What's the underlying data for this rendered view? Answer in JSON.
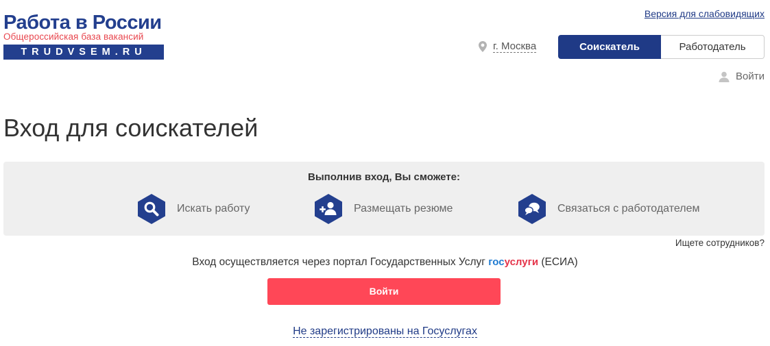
{
  "header": {
    "logo": {
      "title": "Работа в России",
      "subtitle": "Общероссийская база вакансий",
      "domain": "TRUDVSEM.RU"
    },
    "accessibility_link": "Версия для слабовидящих",
    "city": {
      "icon": "map-pin-icon",
      "label": "г. Москва"
    },
    "roles": {
      "applicant": "Соискатель",
      "employer": "Работодатель",
      "selected": "applicant"
    },
    "login": {
      "icon": "user-icon",
      "label": "Войти"
    }
  },
  "main": {
    "title": "Вход для соискателей",
    "benefits": {
      "heading": "Выполнив вход, Вы сможете:",
      "items": [
        {
          "icon": "search-icon",
          "label": "Искать работу"
        },
        {
          "icon": "add-user-icon",
          "label": "Размещать резюме"
        },
        {
          "icon": "chat-icon",
          "label": "Связаться с работодателем"
        }
      ]
    },
    "employers_link": "Ищете сотрудников?",
    "esia": {
      "prefix": "Вход осуществляется через портал Государственных Услуг",
      "logo_part1": "гос",
      "logo_part2": "услуги",
      "suffix": "(ЕСИА)"
    },
    "login_button": "Войти",
    "not_registered_link": "Не зарегистрированы на Госуслугах"
  },
  "colors": {
    "brand_blue": "#1f3a86",
    "accent_red": "#ff4757",
    "panel_gray": "#efefef",
    "gosuslugi_blue": "#1f7bd1",
    "gosuslugi_red": "#e5344a"
  }
}
